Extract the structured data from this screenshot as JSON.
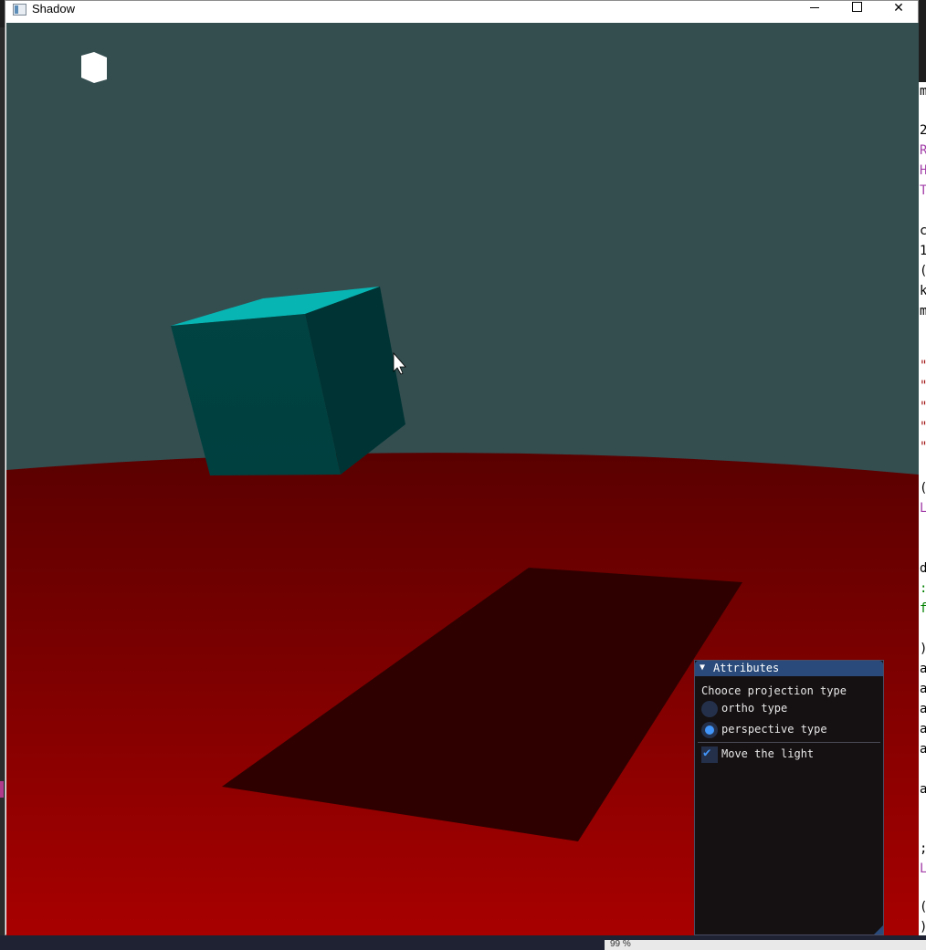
{
  "window": {
    "title": "Shadow"
  },
  "panel": {
    "title": "Attributes",
    "projection_label": "Chooce projection type",
    "options": [
      {
        "label": "ortho type",
        "selected": false
      },
      {
        "label": "perspective type",
        "selected": true
      }
    ],
    "move_light": {
      "label": "Move the light",
      "checked": true
    }
  },
  "background": {
    "zoom_text": "99 %",
    "editor_chars": [
      "m",
      "2",
      "R",
      "H",
      "T",
      "c",
      "1",
      "(",
      "k",
      "m",
      "\"",
      "\"",
      "\"",
      "\"",
      "\"",
      "(",
      "L",
      "d",
      ":",
      "f",
      ")",
      "a",
      "a",
      "a",
      "a",
      "a",
      "a",
      ";",
      "L",
      "(",
      ")"
    ]
  },
  "colors": {
    "sky": "#344e50",
    "floor_far": "#5a0000",
    "floor_near": "#a80000",
    "shadow": "#2f0000",
    "cube_top": "#07b5b3",
    "cube_front": "#004241",
    "cube_side": "#003232",
    "light_cube": "#ffffff",
    "panel_header": "#294a7a",
    "accent": "#4296fa"
  }
}
